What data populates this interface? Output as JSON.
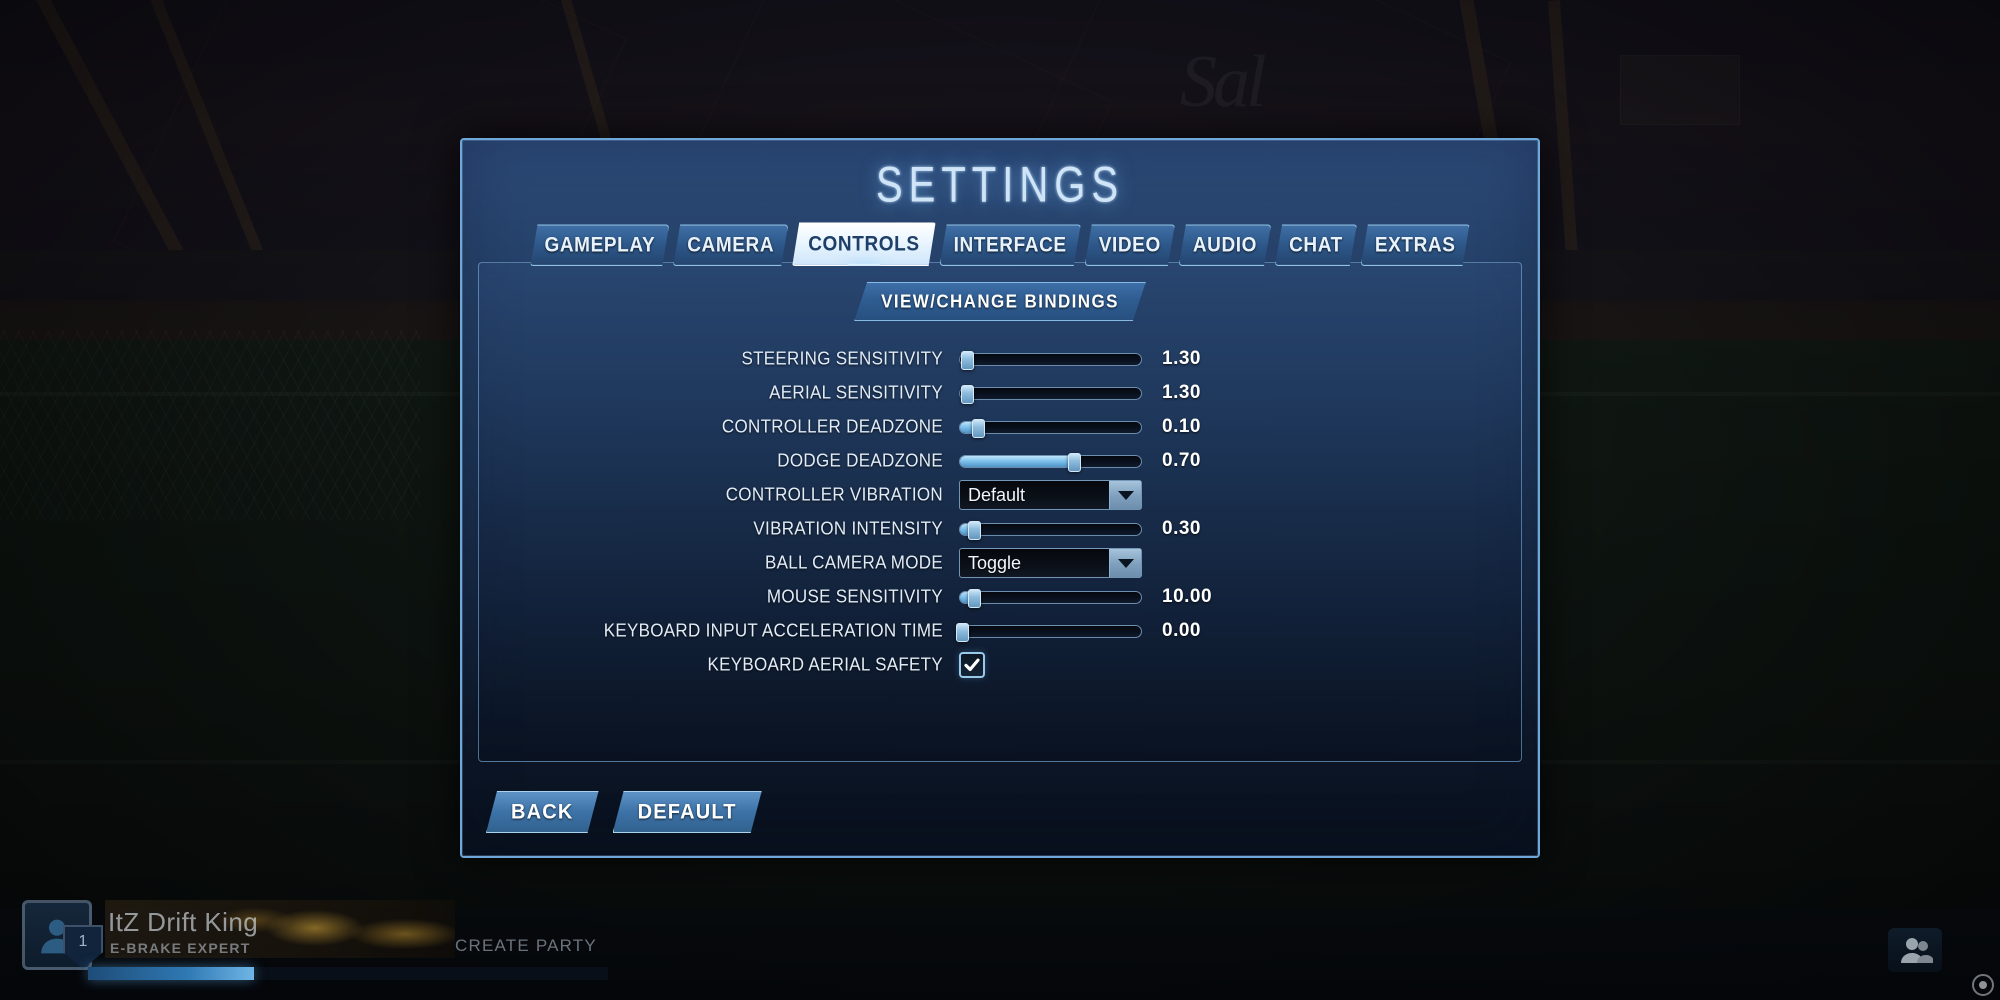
{
  "window": {
    "title": "SETTINGS"
  },
  "tabs": [
    {
      "id": "gameplay",
      "label": "GAMEPLAY",
      "active": false
    },
    {
      "id": "camera",
      "label": "CAMERA",
      "active": false
    },
    {
      "id": "controls",
      "label": "CONTROLS",
      "active": true
    },
    {
      "id": "interface",
      "label": "INTERFACE",
      "active": false
    },
    {
      "id": "video",
      "label": "VIDEO",
      "active": false
    },
    {
      "id": "audio",
      "label": "AUDIO",
      "active": false
    },
    {
      "id": "chat",
      "label": "CHAT",
      "active": false
    },
    {
      "id": "extras",
      "label": "EXTRAS",
      "active": false
    }
  ],
  "bindings_button": {
    "label": "VIEW/CHANGE BINDINGS"
  },
  "settings_rows": [
    {
      "id": "steering-sensitivity",
      "label": "STEERING SENSITIVITY",
      "type": "slider",
      "value": "1.30",
      "percent": 4,
      "filled": false
    },
    {
      "id": "aerial-sensitivity",
      "label": "AERIAL SENSITIVITY",
      "type": "slider",
      "value": "1.30",
      "percent": 4,
      "filled": false
    },
    {
      "id": "controller-deadzone",
      "label": "CONTROLLER DEADZONE",
      "type": "slider",
      "value": "0.10",
      "percent": 10,
      "filled": true
    },
    {
      "id": "dodge-deadzone",
      "label": "DODGE DEADZONE",
      "type": "slider",
      "value": "0.70",
      "percent": 63,
      "filled": true
    },
    {
      "id": "controller-vibration",
      "label": "CONTROLLER VIBRATION",
      "type": "dropdown",
      "value": "Default"
    },
    {
      "id": "vibration-intensity",
      "label": "VIBRATION INTENSITY",
      "type": "slider",
      "value": "0.30",
      "percent": 8,
      "filled": true
    },
    {
      "id": "ball-camera-mode",
      "label": "BALL CAMERA MODE",
      "type": "dropdown",
      "value": "Toggle"
    },
    {
      "id": "mouse-sensitivity",
      "label": "MOUSE SENSITIVITY",
      "type": "slider",
      "value": "10.00",
      "percent": 8,
      "filled": true
    },
    {
      "id": "keyboard-input-acceleration",
      "label": "KEYBOARD INPUT ACCELERATION TIME",
      "type": "slider",
      "value": "0.00",
      "percent": 1,
      "filled": false
    },
    {
      "id": "keyboard-aerial-safety",
      "label": "KEYBOARD AERIAL SAFETY",
      "type": "checkbox",
      "checked": true
    }
  ],
  "footer": {
    "back_label": "BACK",
    "default_label": "DEFAULT"
  },
  "hud": {
    "player_name": "ItZ Drift King",
    "player_title": "E-BRAKE EXPERT",
    "level": "1",
    "create_party_label": "CREATE PARTY"
  },
  "colors": {
    "accent": "#7fc2ee",
    "panel_border": "#6fa8d8",
    "active_tab_bg": "#ffffff",
    "active_tab_text": "#1d3f68",
    "tab_bg": "#2d5789",
    "value_text": "#ffffff"
  }
}
